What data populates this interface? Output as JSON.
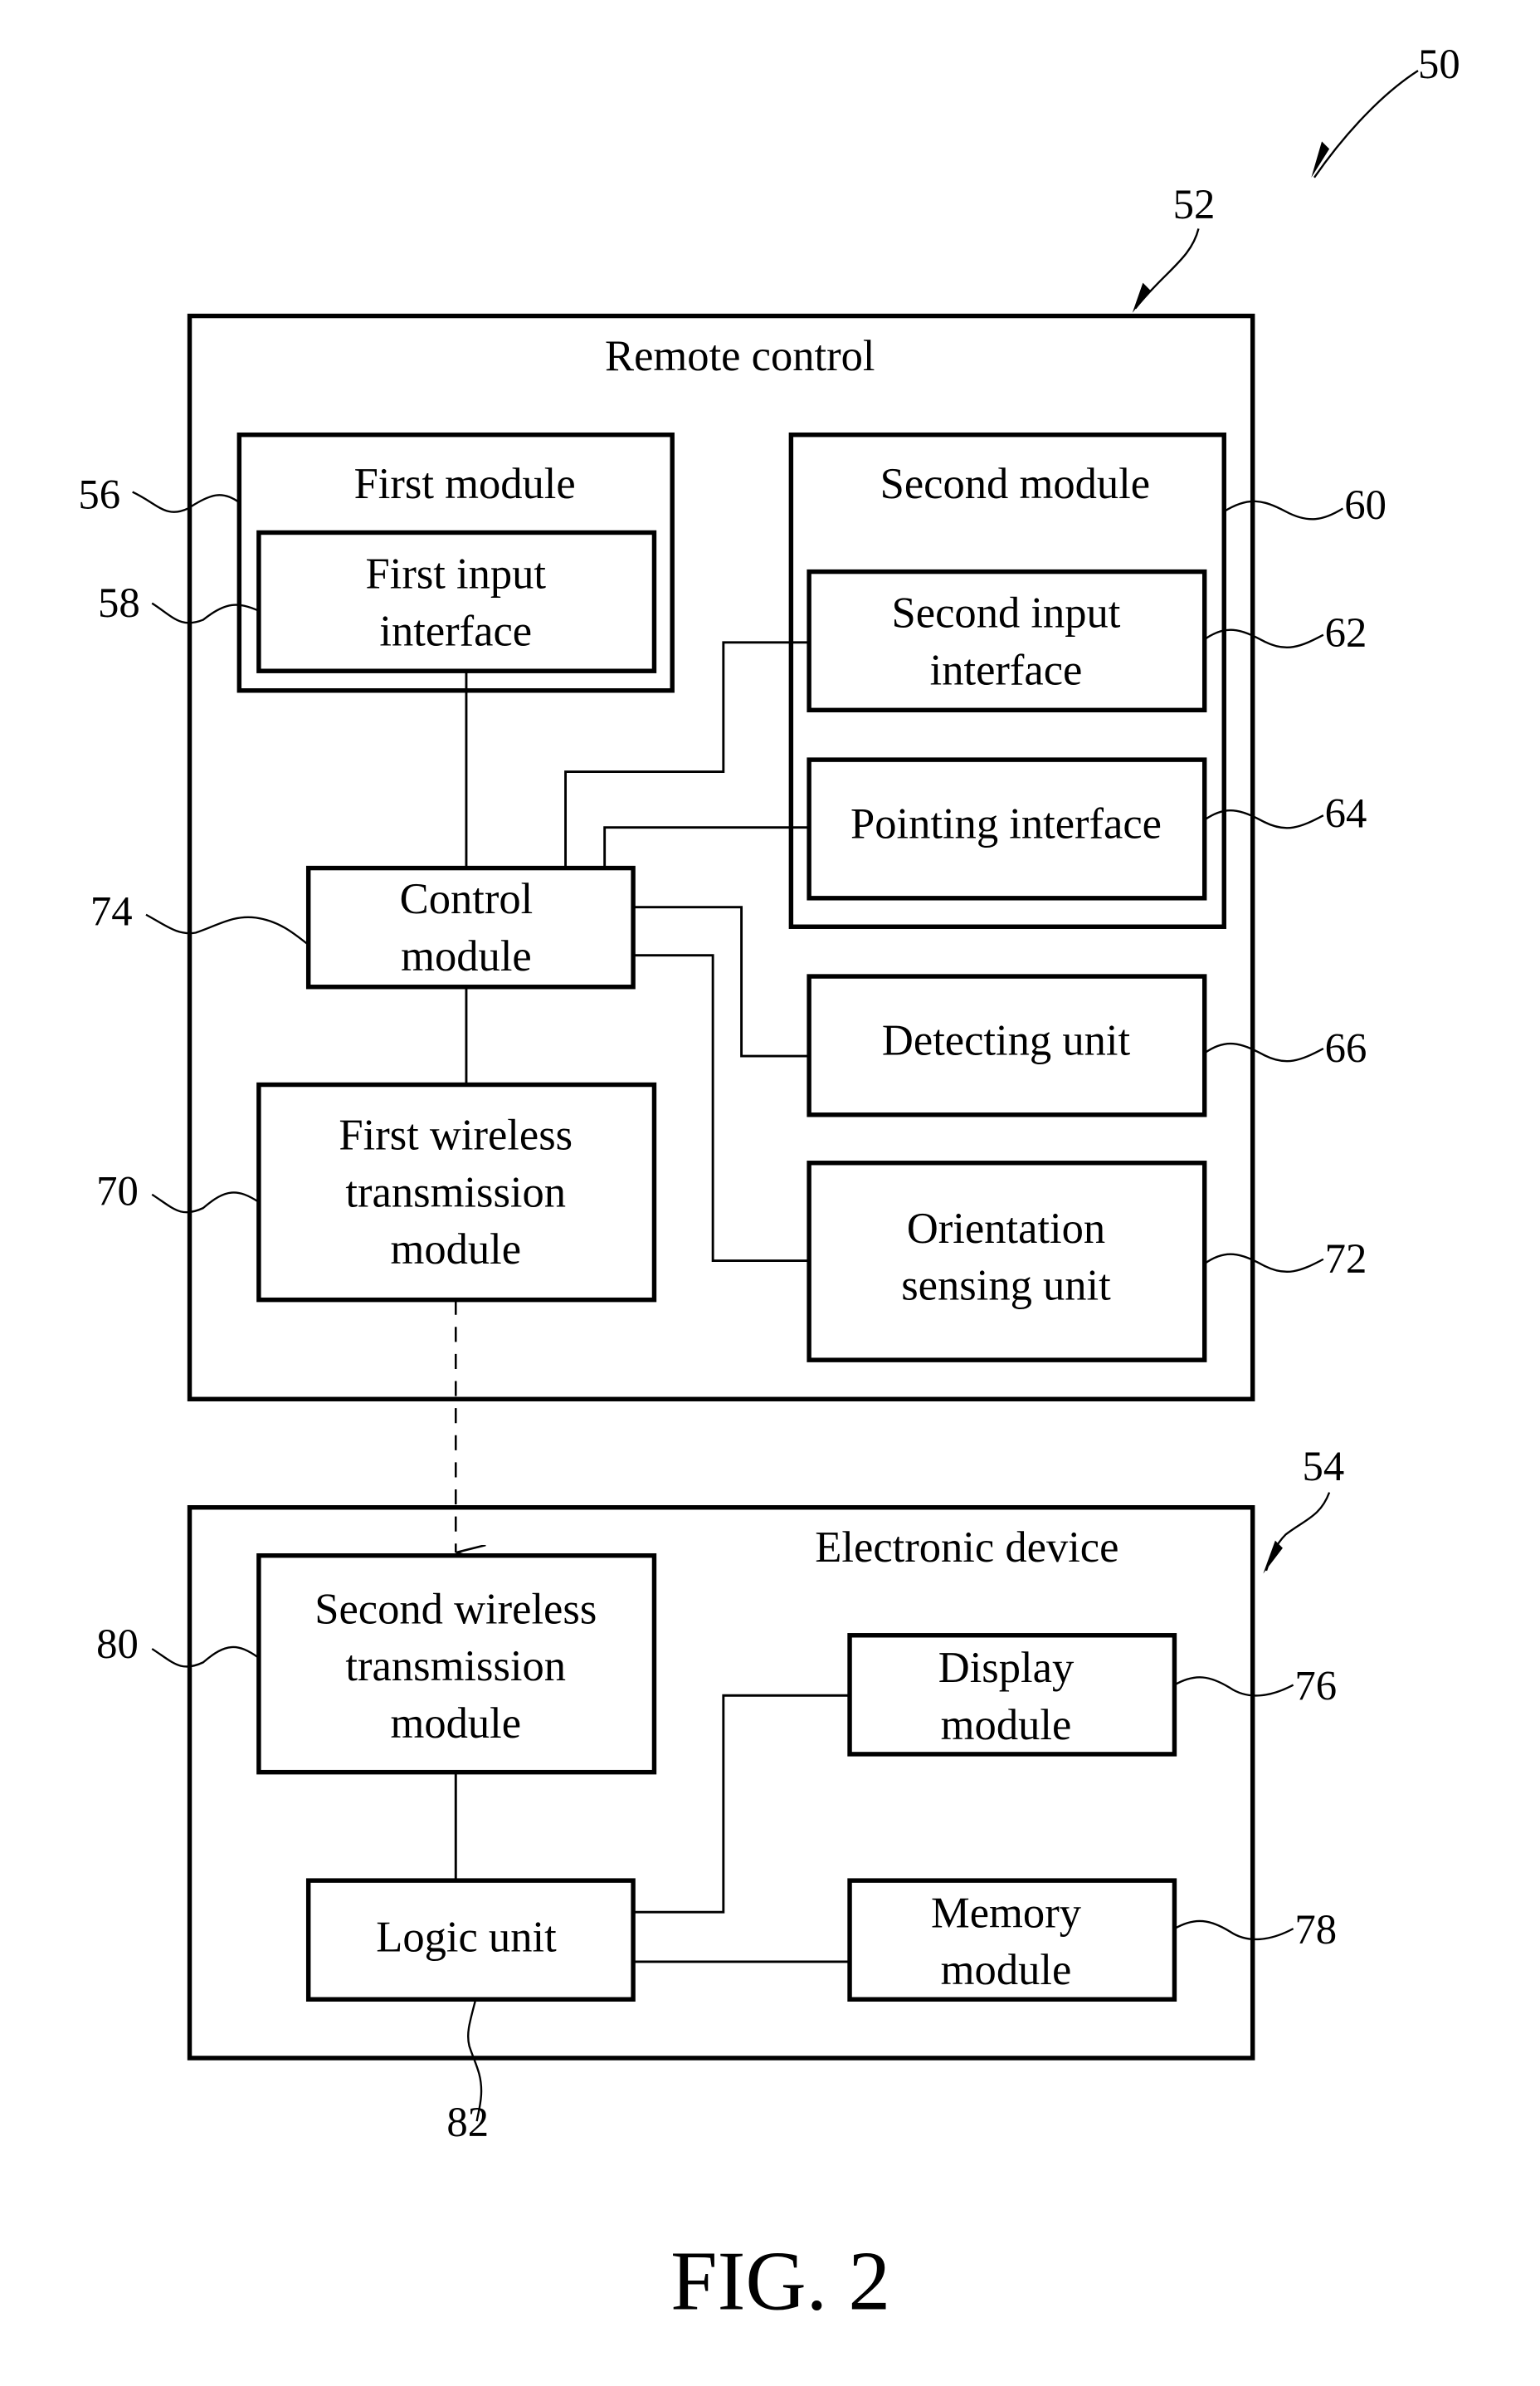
{
  "figure": {
    "caption": "FIG. 2",
    "system_ref": "50"
  },
  "remote_control": {
    "ref": "52",
    "title": "Remote control",
    "first_module": {
      "ref": "56",
      "title": "First module",
      "first_input_interface": {
        "ref": "58",
        "lines": [
          "First input",
          "interface"
        ]
      }
    },
    "second_module": {
      "ref": "60",
      "title": "Second module",
      "second_input_interface": {
        "ref": "62",
        "lines": [
          "Second input",
          "interface"
        ]
      },
      "pointing_interface": {
        "ref": "64",
        "lines": [
          "Pointing interface"
        ]
      }
    },
    "control_module": {
      "ref": "74",
      "lines": [
        "Control",
        "module"
      ]
    },
    "first_wireless": {
      "ref": "70",
      "lines": [
        "First wireless",
        "transmission",
        "module"
      ]
    },
    "detecting_unit": {
      "ref": "66",
      "lines": [
        "Detecting unit"
      ]
    },
    "orientation_unit": {
      "ref": "72",
      "lines": [
        "Orientation",
        "sensing unit"
      ]
    }
  },
  "electronic_device": {
    "ref": "54",
    "title": "Electronic device",
    "second_wireless": {
      "ref": "80",
      "lines": [
        "Second wireless",
        "transmission",
        "module"
      ]
    },
    "display_module": {
      "ref": "76",
      "lines": [
        "Display",
        "module"
      ]
    },
    "logic_unit": {
      "ref": "82",
      "lines": [
        "Logic unit"
      ]
    },
    "memory_module": {
      "ref": "78",
      "lines": [
        "Memory",
        "module"
      ]
    }
  },
  "connections": [
    {
      "from": "First input interface",
      "to": "Control module",
      "type": "wired"
    },
    {
      "from": "Second input interface",
      "to": "Control module",
      "type": "wired"
    },
    {
      "from": "Pointing interface",
      "to": "Control module",
      "type": "wired"
    },
    {
      "from": "Control module",
      "to": "Detecting unit",
      "type": "wired"
    },
    {
      "from": "Control module",
      "to": "Orientation sensing unit",
      "type": "wired"
    },
    {
      "from": "Control module",
      "to": "First wireless transmission module",
      "type": "wired"
    },
    {
      "from": "First wireless transmission module",
      "to": "Second wireless transmission module",
      "type": "wireless"
    },
    {
      "from": "Second wireless transmission module",
      "to": "Logic unit",
      "type": "wired"
    },
    {
      "from": "Logic unit",
      "to": "Display module",
      "type": "wired"
    },
    {
      "from": "Logic unit",
      "to": "Memory module",
      "type": "wired"
    }
  ]
}
